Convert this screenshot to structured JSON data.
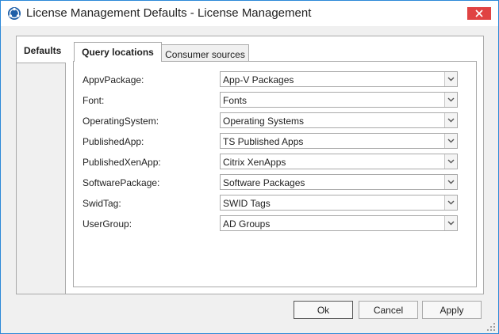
{
  "window": {
    "title": "License Management Defaults - License Management",
    "app_icon": "globe-network-icon",
    "close_icon": "close-icon"
  },
  "outer_tabs": [
    {
      "label": "Defaults",
      "selected": true
    }
  ],
  "inner_tabs": [
    {
      "label": "Query locations",
      "selected": true
    },
    {
      "label": "Consumer sources",
      "selected": false
    }
  ],
  "query_locations": [
    {
      "label": "AppvPackage:",
      "value": "App-V Packages"
    },
    {
      "label": "Font:",
      "value": "Fonts"
    },
    {
      "label": "OperatingSystem:",
      "value": "Operating Systems"
    },
    {
      "label": "PublishedApp:",
      "value": "TS Published Apps"
    },
    {
      "label": "PublishedXenApp:",
      "value": "Citrix XenApps"
    },
    {
      "label": "SoftwarePackage:",
      "value": "Software Packages"
    },
    {
      "label": "SwidTag:",
      "value": "SWID Tags"
    },
    {
      "label": "UserGroup:",
      "value": "AD Groups"
    }
  ],
  "buttons": {
    "ok": "Ok",
    "cancel": "Cancel",
    "apply": "Apply"
  },
  "colors": {
    "accent": "#2b88d8",
    "close": "#e04343"
  }
}
